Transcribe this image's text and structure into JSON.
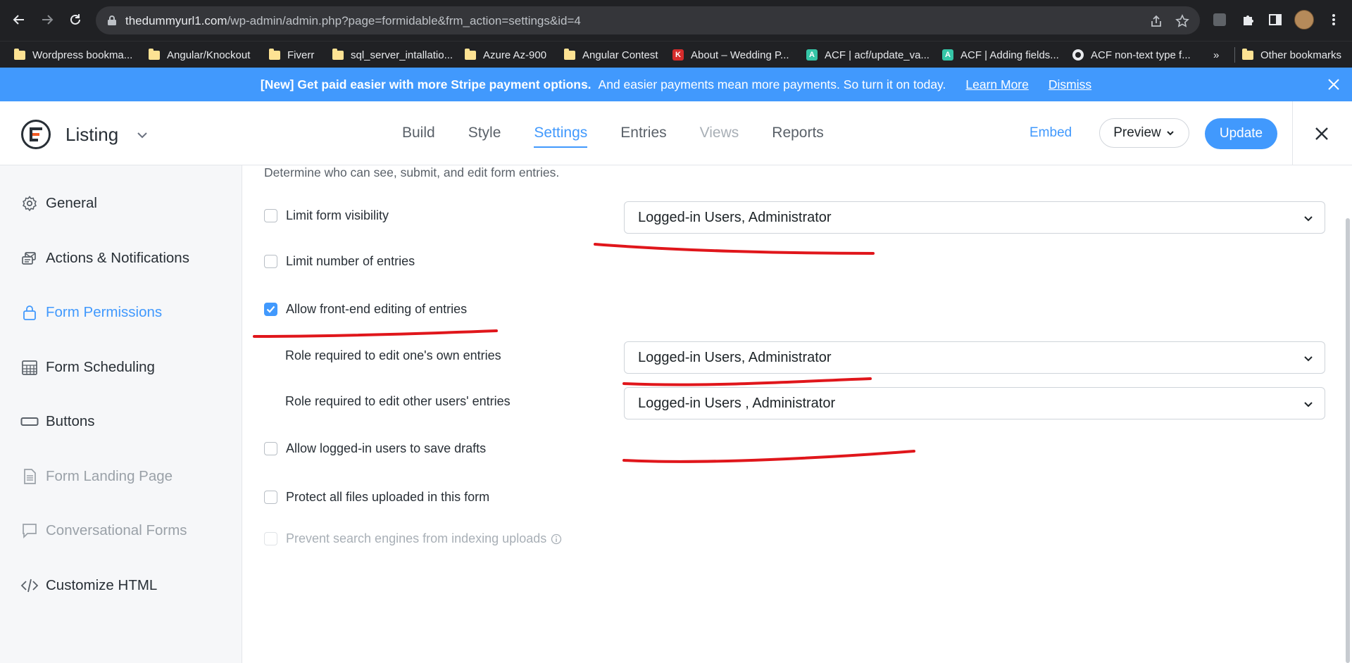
{
  "browser": {
    "url_host": "thedummyurl1.com",
    "url_path": "/wp-admin/admin.php?page=formidable&frm_action=settings&id=4",
    "bookmarks": [
      {
        "label": "Wordpress bookma...",
        "icon": "folder-icon"
      },
      {
        "label": "Angular/Knockout",
        "icon": "folder-icon"
      },
      {
        "label": "Fiverr",
        "icon": "folder-icon"
      },
      {
        "label": "sql_server_intallatio...",
        "icon": "folder-icon"
      },
      {
        "label": "Azure Az-900",
        "icon": "folder-icon"
      },
      {
        "label": "Angular Contest",
        "icon": "folder-icon"
      },
      {
        "label": "About – Wedding P...",
        "icon": "wedding-site-icon"
      },
      {
        "label": "ACF | acf/update_va...",
        "icon": "acf-icon"
      },
      {
        "label": "ACF | Adding fields...",
        "icon": "acf-icon"
      },
      {
        "label": "ACF non-text type f...",
        "icon": "github-icon"
      },
      {
        "label": "»",
        "icon": ""
      },
      {
        "label": "Other bookmarks",
        "icon": "folder-icon"
      }
    ]
  },
  "notice": {
    "bold": "[New] Get paid easier with more Stripe payment options.",
    "text": "And easier payments mean more payments. So turn it on today.",
    "learn_more": "Learn More",
    "dismiss": "Dismiss"
  },
  "header": {
    "form_title": "Listing",
    "tabs": [
      {
        "label": "Build",
        "state": "normal"
      },
      {
        "label": "Style",
        "state": "normal"
      },
      {
        "label": "Settings",
        "state": "active"
      },
      {
        "label": "Entries",
        "state": "normal"
      },
      {
        "label": "Views",
        "state": "disabled"
      },
      {
        "label": "Reports",
        "state": "normal"
      }
    ],
    "embed": "Embed",
    "preview": "Preview",
    "update": "Update"
  },
  "sidebar": {
    "items": [
      {
        "label": "General",
        "icon": "gear-icon",
        "state": "normal"
      },
      {
        "label": "Actions & Notifications",
        "icon": "notifications-icon",
        "state": "normal"
      },
      {
        "label": "Form Permissions",
        "icon": "lock-icon",
        "state": "active"
      },
      {
        "label": "Form Scheduling",
        "icon": "calendar-icon",
        "state": "normal"
      },
      {
        "label": "Buttons",
        "icon": "button-icon",
        "state": "normal"
      },
      {
        "label": "Form Landing Page",
        "icon": "document-icon",
        "state": "muted"
      },
      {
        "label": "Conversational Forms",
        "icon": "chat-icon",
        "state": "muted"
      },
      {
        "label": "Customize HTML",
        "icon": "code-icon",
        "state": "normal"
      }
    ]
  },
  "permissions": {
    "description": "Determine who can see, submit, and edit form entries.",
    "limit_visibility": {
      "label": "Limit form visibility",
      "checked": false,
      "value": "Logged-in Users, Administrator"
    },
    "limit_entries": {
      "label": "Limit number of entries",
      "checked": false
    },
    "frontend_editing": {
      "label": "Allow front-end editing of entries",
      "checked": true
    },
    "edit_own": {
      "label": "Role required to edit one's own entries",
      "value": "Logged-in Users, Administrator"
    },
    "edit_others": {
      "label": "Role required to edit other users' entries",
      "value": "Logged-in Users , Administrator"
    },
    "save_drafts": {
      "label": "Allow logged-in users to save drafts",
      "checked": false
    },
    "protect_files": {
      "label": "Protect all files uploaded in this form",
      "checked": false
    },
    "prevent_indexing": {
      "label": "Prevent search engines from indexing uploads",
      "checked": false,
      "disabled": true
    }
  },
  "colors": {
    "accent": "#4199fd",
    "annotation": "#e0161b",
    "chrome": "#202124"
  }
}
